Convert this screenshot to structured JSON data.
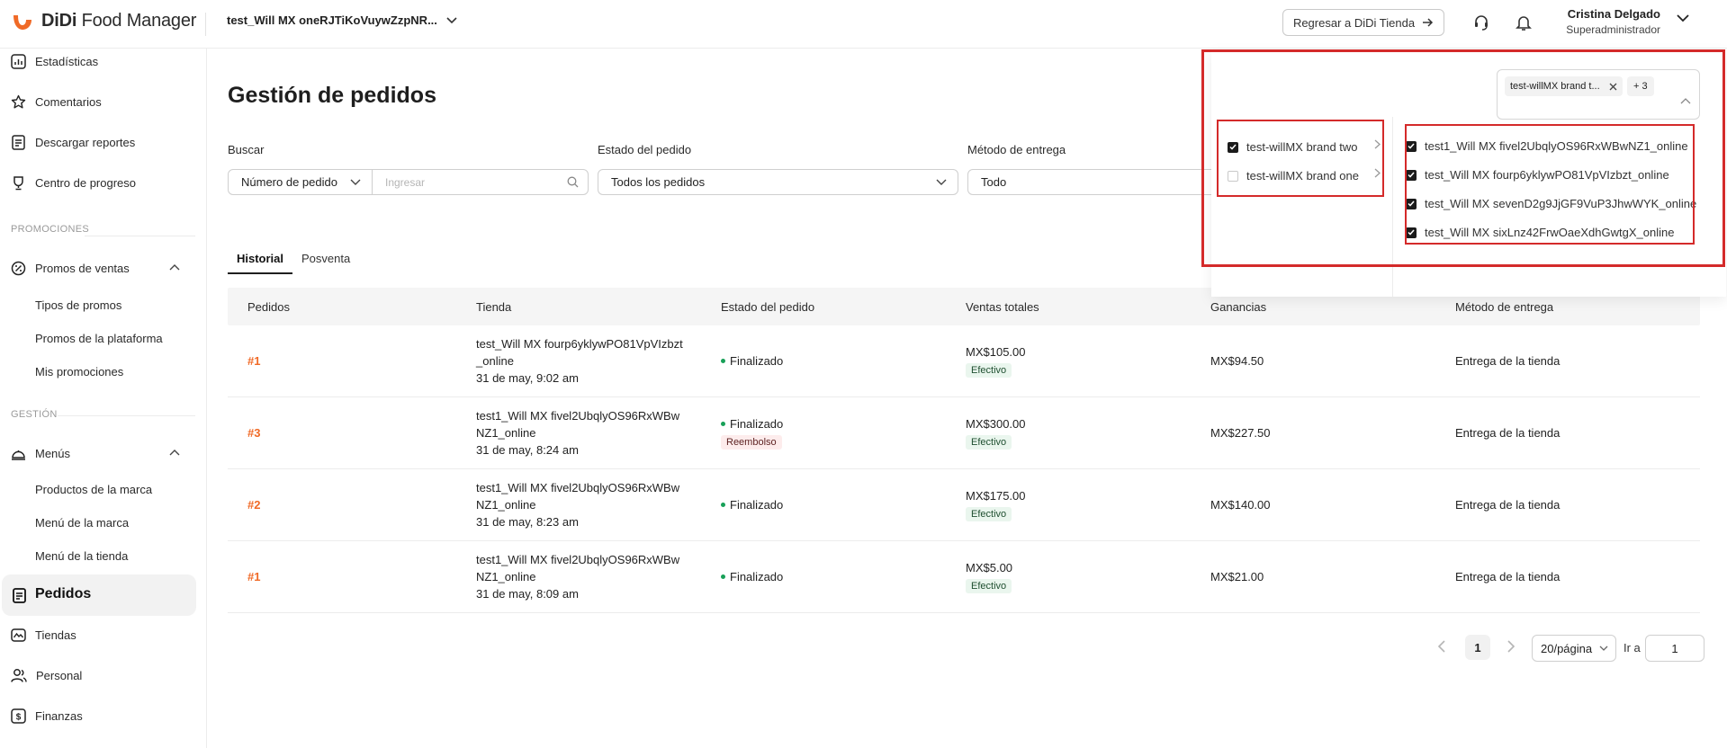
{
  "header": {
    "logo_brand": "DiDi",
    "logo_product": "Food Manager",
    "store_selector": "test_Will MX oneRJTiKoVuywZzpNR...",
    "back_button": "Regresar a DiDi Tienda",
    "user_name": "Cristina Delgado",
    "user_role": "Superadministrador"
  },
  "sidebar": {
    "items_top": [
      {
        "label": "Estadísticas",
        "icon": "chart-icon"
      },
      {
        "label": "Comentarios",
        "icon": "star-icon"
      },
      {
        "label": "Descargar reportes",
        "icon": "report-icon"
      },
      {
        "label": "Centro de progreso",
        "icon": "trophy-icon"
      }
    ],
    "section_promos": "PROMOCIONES",
    "promos_parent": "Promos de ventas",
    "promos_children": [
      "Tipos de promos",
      "Promos de la plataforma",
      "Mis promociones"
    ],
    "section_gestion": "GESTIÓN",
    "menus_parent": "Menús",
    "menus_children": [
      "Productos de la marca",
      "Menú de la marca",
      "Menú de la tienda"
    ],
    "active_item": "Pedidos",
    "items_bottom": [
      {
        "label": "Tiendas",
        "icon": "stores-icon"
      },
      {
        "label": "Personal",
        "icon": "people-icon"
      },
      {
        "label": "Finanzas",
        "icon": "dollar-icon"
      }
    ]
  },
  "main": {
    "title": "Gestión de pedidos",
    "filters": {
      "search_label": "Buscar",
      "search_type": "Número de pedido",
      "search_placeholder": "Ingresar",
      "status_label": "Estado del pedido",
      "status_value": "Todos los pedidos",
      "delivery_label": "Método de entrega",
      "delivery_value": "Todo"
    },
    "tabs": [
      "Historial",
      "Posventa"
    ],
    "table": {
      "columns": [
        "Pedidos",
        "Tienda",
        "Estado del pedido",
        "Ventas totales",
        "Ganancias",
        "Método de entrega"
      ],
      "rows": [
        {
          "id": "#1",
          "store": "test_Will MX fourp6yklywPO81VpVIzbzt_online",
          "date": "31 de may, 9:02 am",
          "status": "Finalizado",
          "status_badge": "",
          "total": "MX$105.00",
          "payment": "Efectivo",
          "earnings": "MX$94.50",
          "delivery": "Entrega de la tienda"
        },
        {
          "id": "#3",
          "store": "test1_Will MX fivel2UbqlyOS96RxWBwNZ1_online",
          "date": "31 de may, 8:24 am",
          "status": "Finalizado",
          "status_badge": "Reembolso",
          "total": "MX$300.00",
          "payment": "Efectivo",
          "earnings": "MX$227.50",
          "delivery": "Entrega de la tienda"
        },
        {
          "id": "#2",
          "store": "test1_Will MX fivel2UbqlyOS96RxWBwNZ1_online",
          "date": "31 de may, 8:23 am",
          "status": "Finalizado",
          "status_badge": "",
          "total": "MX$175.00",
          "payment": "Efectivo",
          "earnings": "MX$140.00",
          "delivery": "Entrega de la tienda"
        },
        {
          "id": "#1",
          "store": "test1_Will MX fivel2UbqlyOS96RxWBwNZ1_online",
          "date": "31 de may, 8:09 am",
          "status": "Finalizado",
          "status_badge": "",
          "total": "MX$5.00",
          "payment": "Efectivo",
          "earnings": "MX$21.00",
          "delivery": "Entrega de la tienda"
        }
      ]
    },
    "pagination": {
      "current_page": "1",
      "page_size": "20/página",
      "goto_label": "Ir a",
      "goto_value": "1"
    }
  },
  "brand_dropdown": {
    "chip_label": "test-willMX brand t...",
    "chip_more": "+ 3",
    "brands": [
      {
        "label": "test-willMX brand two",
        "checked": true
      },
      {
        "label": "test-willMX brand one",
        "checked": false
      }
    ],
    "stores": [
      {
        "label": "test1_Will MX fivel2UbqlyOS96RxWBwNZ1_online",
        "checked": true
      },
      {
        "label": "test_Will MX fourp6yklywPO81VpVIzbzt_online",
        "checked": true
      },
      {
        "label": "test_Will MX sevenD2g9JjGF9VuP3JhwWYK_online",
        "checked": true
      },
      {
        "label": "test_Will MX sixLnz42FrwOaeXdhGwtgX_online",
        "checked": true
      }
    ]
  },
  "colors": {
    "accent": "#f06a27",
    "highlight": "#d42a2a",
    "status_green": "#18a058"
  }
}
